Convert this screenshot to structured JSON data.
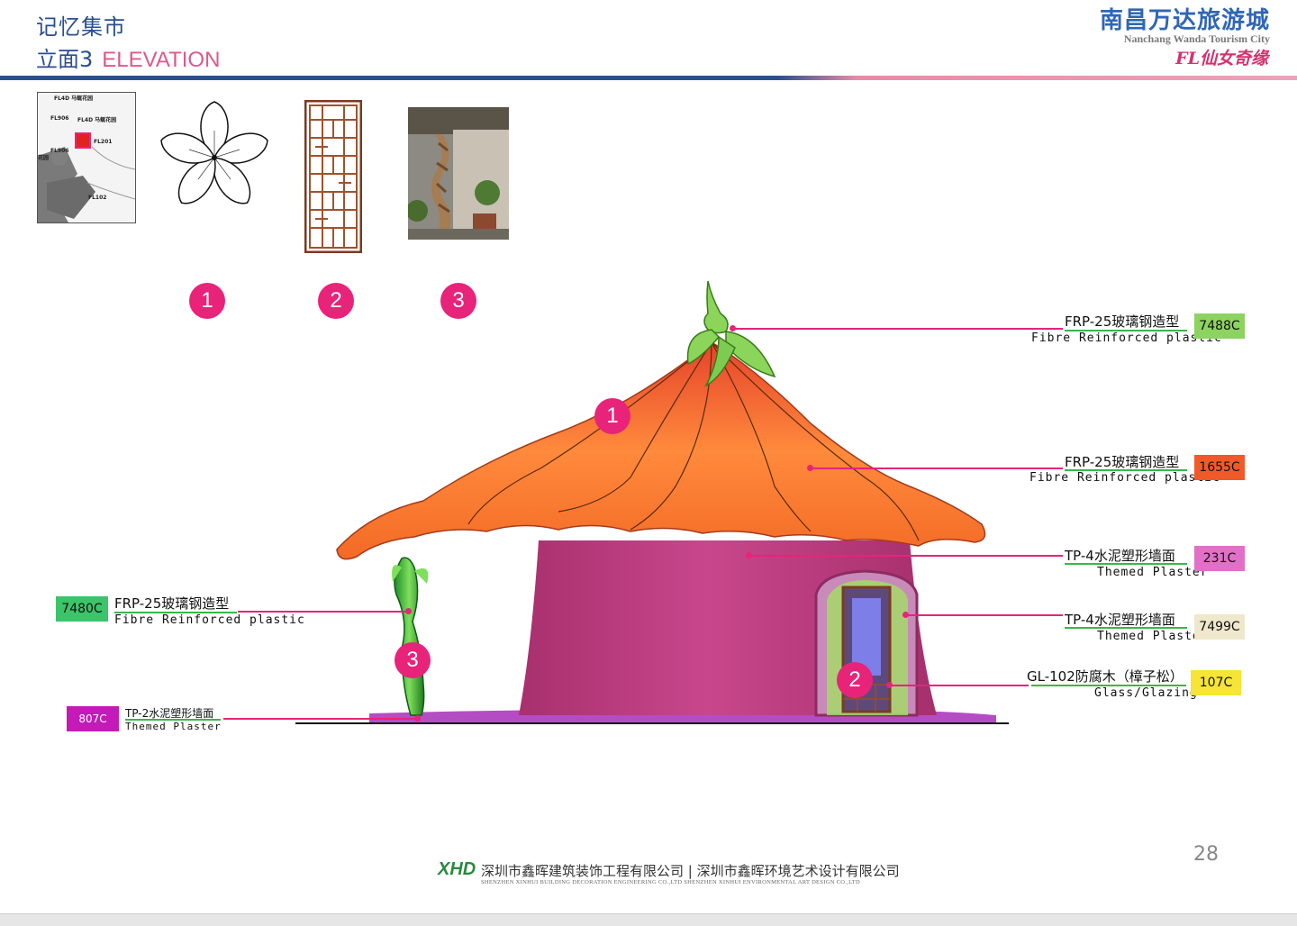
{
  "header": {
    "title": "记忆集市",
    "subtitle_cn": "立面3",
    "subtitle_en": "ELEVATION",
    "brand_cn": "南昌万达旅游城",
    "brand_en": "Nanchang Wanda Tourism City",
    "brand_fl": "FL仙女奇缘"
  },
  "site_plan": {
    "labels": [
      "FL4D 马蜒花园",
      "FL906",
      "FL4D 马蜒花园",
      "FL201",
      "FL906",
      "花园",
      "FL102"
    ]
  },
  "references": [
    {
      "number": "1",
      "icon": "flower-icon"
    },
    {
      "number": "2",
      "icon": "lattice-screen-icon"
    },
    {
      "number": "3",
      "icon": "twisted-column-photo"
    }
  ],
  "markers": {
    "roof": "1",
    "door": "2",
    "vine": "3"
  },
  "callouts": [
    {
      "cn": "FRP-25玻璃钢造型",
      "en": "Fibre Reinforced plastic",
      "code": "7488C",
      "color": "#8dd35f"
    },
    {
      "cn": "FRP-25玻璃钢造型",
      "en": "Fibre Reinforced plastic",
      "code": "1655C",
      "color": "#f05a28"
    },
    {
      "cn": "TP-4水泥塑形墙面",
      "en": "Themed Plaster",
      "code": "231C",
      "color": "#e070c8"
    },
    {
      "cn": "TP-4水泥塑形墙面",
      "en": "Themed Plaster",
      "code": "7499C",
      "color": "#efe8cc"
    },
    {
      "cn": "GL-102防腐木（樟子松）",
      "en": "Glass/Glazing",
      "code": "107C",
      "color": "#f6e436"
    },
    {
      "cn": "FRP-25玻璃钢造型",
      "en": "Fibre Reinforced plastic",
      "code": "7480C",
      "color": "#3cc46a"
    },
    {
      "cn": "TP-2水泥塑形墙面",
      "en": "Themed Plaster",
      "code": "807C",
      "color": "#c41ab8"
    }
  ],
  "footer": {
    "logo": "XHD",
    "company_cn": "深圳市鑫晖建筑装饰工程有限公司 | 深圳市鑫晖环境艺术设计有限公司",
    "company_en": "SHENZHEN XINHUI BUILDING DECORATION ENGINEERING CO.,LTD      SHENZHEN XINHUI ENVIRONMENTAL ART DESIGN CO.,LTD",
    "page_number": "28"
  },
  "colors": {
    "header_blue": "#2a4f8f",
    "header_pink": "#e88aa8",
    "accent_pink": "#e8237a",
    "underline_green": "#3bb54a"
  }
}
